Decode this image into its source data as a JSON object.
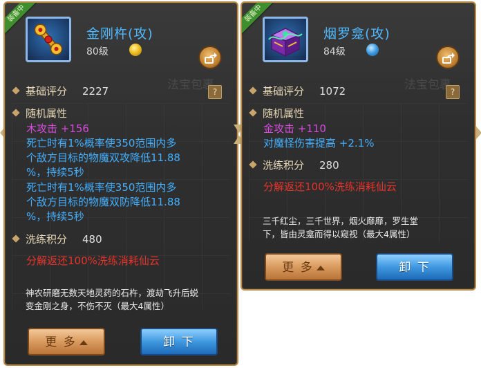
{
  "left_panel": {
    "badge": "装备中",
    "title": "金刚杵(攻)",
    "level": "80级",
    "ghost_label": "法宝包裹",
    "help": "?",
    "base_score_label": "基础评分",
    "base_score_value": "2227",
    "random_attr_label": "随机属性",
    "attr_lines": [
      "木攻击 +156",
      "死亡时有1%概率使350范围内多",
      "个敌方目标的物魔双攻降低11.88",
      "%，持续5秒",
      "死亡时有1%概率使350范围内多",
      "个敌方目标的物魔双防降低11.88",
      "%，持续5秒"
    ],
    "refine_label": "洗练积分",
    "refine_value": "480",
    "refund_text": "分解返还100%洗练消耗仙云",
    "description": [
      "神农研磨无数天地灵药的石杵，渡劫飞升后蜕",
      "变金刚之身，不伤不灭（最大4属性）"
    ],
    "more_label": "更 多",
    "unequip_label": "卸 下"
  },
  "right_panel": {
    "badge": "装备中",
    "title": "烟罗龛(攻)",
    "level": "84级",
    "ghost_label": "法宝包裹",
    "help": "?",
    "base_score_label": "基础评分",
    "base_score_value": "1072",
    "random_attr_label": "随机属性",
    "attr_lines": [
      "金攻击 +110",
      "对魔怪伤害提高 +2.1%"
    ],
    "refine_label": "洗练积分",
    "refine_value": "280",
    "refund_text": "分解返还100%洗练消耗仙云",
    "description": [
      "三千红尘，三千世界，烟火靡靡，罗生堂",
      "下，皆由灵龛而得以窥视（最大4属性）"
    ],
    "more_label": "更 多",
    "unequip_label": "卸 下"
  },
  "icons": {
    "left_item": "golden-pestle-icon",
    "right_item": "purple-shrine-box-icon",
    "left_element": "gold-element-icon",
    "right_element": "water-element-icon",
    "share": "share-arrow-icon"
  },
  "colors": {
    "title": "#4fb8ff",
    "attr_element": "#d84ae0",
    "attr_effect": "#44b0ff",
    "refund": "#e8332a",
    "frame": "#b58a4a"
  }
}
